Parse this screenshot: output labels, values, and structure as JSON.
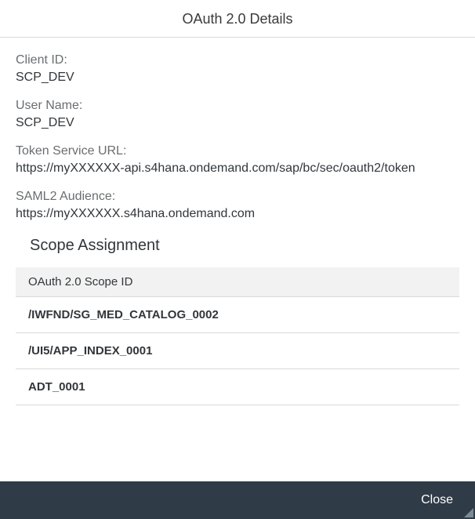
{
  "header": {
    "title": "OAuth 2.0 Details"
  },
  "fields": {
    "client_id": {
      "label": "Client ID:",
      "value": "SCP_DEV"
    },
    "user_name": {
      "label": "User Name:",
      "value": "SCP_DEV"
    },
    "token_service_url": {
      "label": "Token Service URL:",
      "value": "https://myXXXXXX-api.s4hana.ondemand.com/sap/bc/sec/oauth2/token"
    },
    "saml2_audience": {
      "label": "SAML2 Audience:",
      "value": "https://myXXXXXX.s4hana.ondemand.com"
    }
  },
  "scope_section": {
    "title": "Scope Assignment",
    "column_header": "OAuth 2.0 Scope ID",
    "rows": [
      "/IWFND/SG_MED_CATALOG_0002",
      "/UI5/APP_INDEX_0001",
      "ADT_0001"
    ]
  },
  "footer": {
    "close_label": "Close"
  }
}
